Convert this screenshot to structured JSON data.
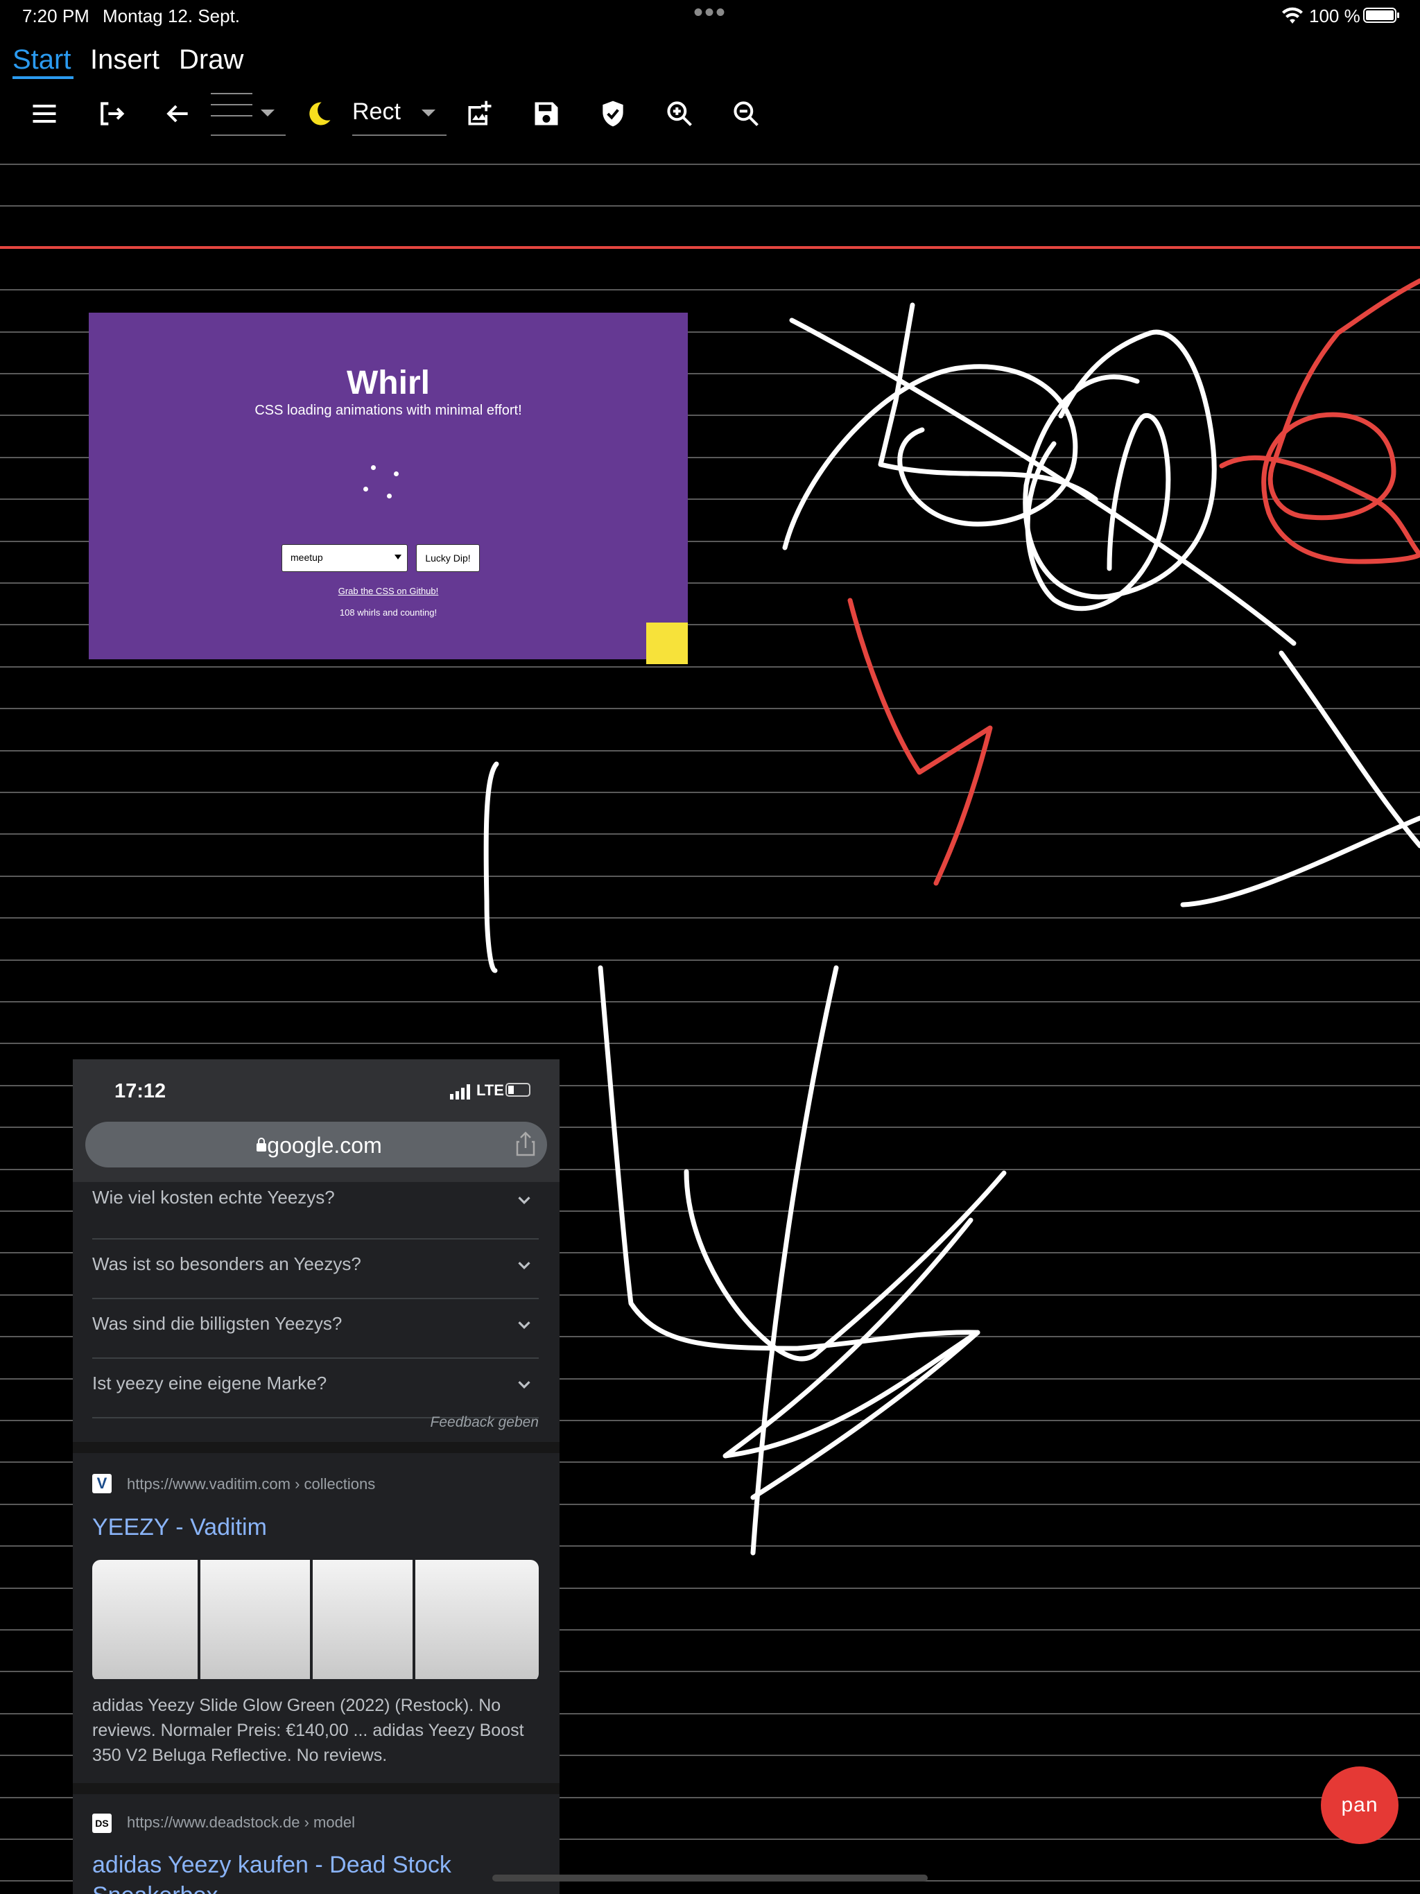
{
  "status_bar": {
    "time": "7:20 PM",
    "date": "Montag 12. Sept.",
    "battery": "100 %",
    "more_dots": "•••"
  },
  "tabs": [
    {
      "label": "Start",
      "active": true
    },
    {
      "label": "Insert",
      "active": false
    },
    {
      "label": "Draw",
      "active": false
    }
  ],
  "toolbar": {
    "shape_select": "Rect",
    "icons": [
      "menu-icon",
      "exit-icon",
      "back-arrow-icon",
      "line-style-dropdown",
      "dark-mode-icon",
      "shape-dropdown",
      "add-image-icon",
      "save-icon",
      "shield-check-icon",
      "zoom-in-icon",
      "zoom-out-icon"
    ]
  },
  "whirl_card": {
    "title": "Whirl",
    "subtitle": "CSS loading animations with minimal effort!",
    "select_value": "meetup",
    "button_label": "Lucky Dip!",
    "link_text": "Grab the CSS on Github!",
    "count_text": "108 whirls and counting!",
    "bg_color": "#653993",
    "accent_color": "#f7e23a"
  },
  "phone": {
    "time": "17:12",
    "network": "LTE",
    "url": "google.com",
    "faq": [
      "Wie viel kosten echte Yeezys?",
      "Was ist so besonders an Yeezys?",
      "Was sind die billigsten Yeezys?",
      "Ist yeezy eine eigene Marke?"
    ],
    "feedback": "Feedback geben",
    "results": [
      {
        "icon_letter": "V",
        "url": "https://www.vaditim.com",
        "crumb": "› collections",
        "title": "YEEZY - Vaditim",
        "snippet": "adidas Yeezy Slide Glow Green (2022) (Restock). No reviews. Normaler Preis: €140,00 ... adidas Yeezy Boost 350 V2 Beluga Reflective. No reviews."
      },
      {
        "icon_letter": "DS",
        "url": "https://www.deadstock.de",
        "crumb": "› model",
        "title": "adidas Yeezy kaufen - Dead Stock Sneakerbox"
      }
    ]
  },
  "pan_button": "pan",
  "colors": {
    "accent": "#2b9bf0",
    "red_line": "#e5453f",
    "pan": "#e53935"
  }
}
